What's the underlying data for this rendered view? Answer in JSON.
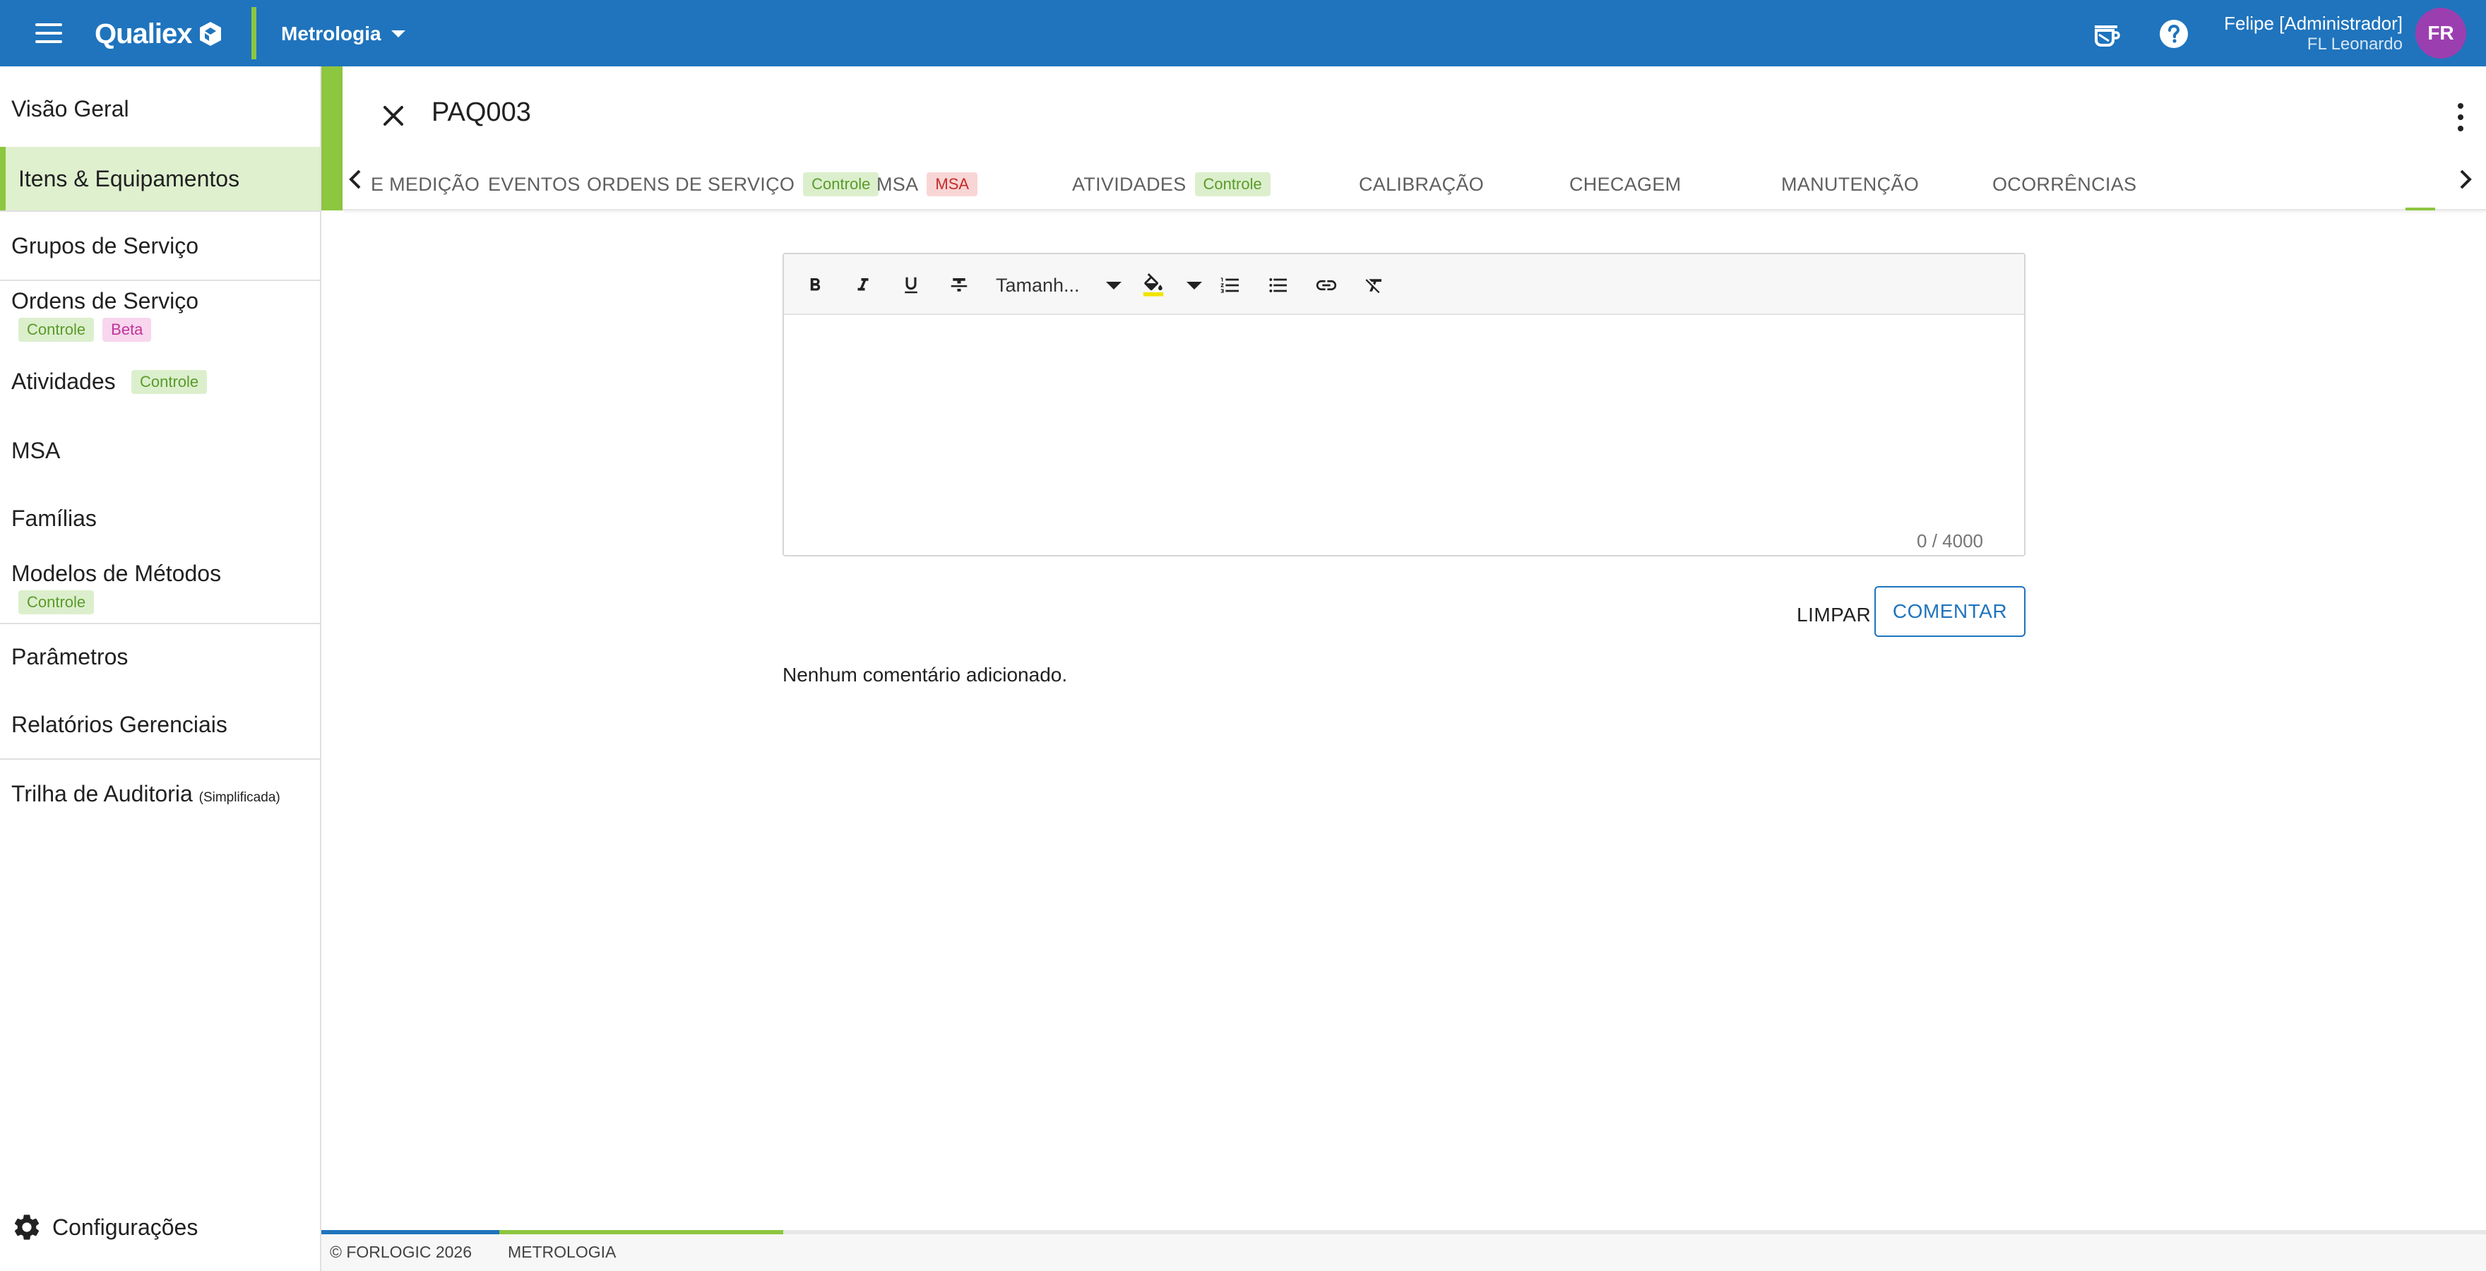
{
  "topbar": {
    "logo_text": "Qualiex",
    "module": "Metrologia",
    "user_name": "Felipe [Administrador]",
    "user_org": "FL Leonardo",
    "avatar_initials": "FR",
    "colors": {
      "primary": "#1f74bd",
      "accent": "#8dc63f",
      "avatar": "#9b3fb0"
    }
  },
  "sidebar": {
    "items": [
      {
        "label": "Visão Geral"
      },
      {
        "label": "Itens & Equipamentos",
        "active": true
      },
      {
        "label": "Grupos de Serviço"
      },
      {
        "label": "Ordens de Serviço",
        "tags": [
          "Controle",
          "Beta"
        ]
      },
      {
        "label": "Atividades",
        "tags": [
          "Controle"
        ]
      },
      {
        "label": "MSA"
      },
      {
        "label": "Famílias"
      },
      {
        "label": "Modelos de Métodos",
        "tags": [
          "Controle"
        ]
      },
      {
        "label": "Parâmetros"
      },
      {
        "label": "Relatórios Gerenciais"
      },
      {
        "label": "Trilha de Auditoria",
        "note": "(Simplificada)"
      }
    ],
    "config_label": "Configurações"
  },
  "detail": {
    "title": "PAQ003",
    "tabs": [
      {
        "label": "E MEDIÇÃO"
      },
      {
        "label": "EVENTOS"
      },
      {
        "label": "ORDENS DE SERVIÇO",
        "tag": "Controle"
      },
      {
        "label": "MSA",
        "tag": "MSA"
      },
      {
        "label": "ATIVIDADES",
        "tag": "Controle"
      },
      {
        "label": "CALIBRAÇÃO"
      },
      {
        "label": "CHECAGEM"
      },
      {
        "label": "MANUTENÇÃO"
      },
      {
        "label": "OCORRÊNCIAS"
      }
    ]
  },
  "editor": {
    "font_size_label": "Tamanh...",
    "counter": "0 / 4000",
    "clear_label": "LIMPAR",
    "submit_label": "COMENTAR",
    "empty_message": "Nenhum comentário adicionado."
  },
  "footer": {
    "copyright": "© FORLOGIC 2026",
    "module": "METROLOGIA"
  }
}
